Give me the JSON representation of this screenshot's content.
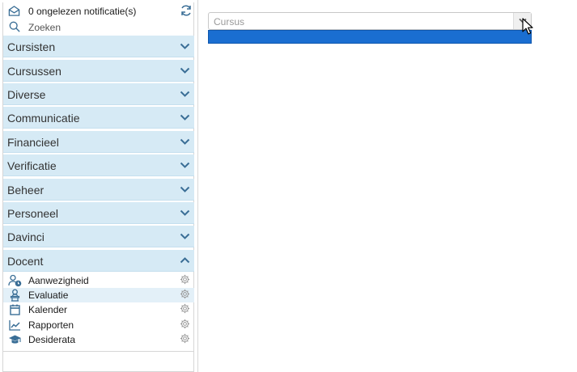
{
  "sidebar": {
    "notifications": {
      "text": "0 ongelezen notificatie(s)",
      "icon": "envelope-open-icon",
      "refresh_icon": "refresh-icon"
    },
    "search": {
      "placeholder": "Zoeken",
      "icon": "search-icon"
    },
    "sections": [
      {
        "label": "Cursisten",
        "expanded": false
      },
      {
        "label": "Cursussen",
        "expanded": false
      },
      {
        "label": "Diverse",
        "expanded": false
      },
      {
        "label": "Communicatie",
        "expanded": false
      },
      {
        "label": "Financieel",
        "expanded": false
      },
      {
        "label": "Verificatie",
        "expanded": false
      },
      {
        "label": "Beheer",
        "expanded": false
      },
      {
        "label": "Personeel",
        "expanded": false
      },
      {
        "label": "Davinci",
        "expanded": false
      },
      {
        "label": "Docent",
        "expanded": true
      }
    ],
    "docent_items": [
      {
        "label": "Aanwezigheid",
        "icon": "user-clock-icon",
        "active": false
      },
      {
        "label": "Evaluatie",
        "icon": "teacher-icon",
        "active": true
      },
      {
        "label": "Kalender",
        "icon": "calendar-icon",
        "active": false
      },
      {
        "label": "Rapporten",
        "icon": "chart-line-icon",
        "active": false
      },
      {
        "label": "Desiderata",
        "icon": "graduation-cap-icon",
        "active": false
      }
    ]
  },
  "main": {
    "course_select": {
      "placeholder": "Cursus",
      "highlight_color": "#1a6ed1"
    }
  },
  "colors": {
    "section_bg": "#d6eaf5",
    "accent": "#1a6ed1",
    "icon": "#3a6e96"
  }
}
